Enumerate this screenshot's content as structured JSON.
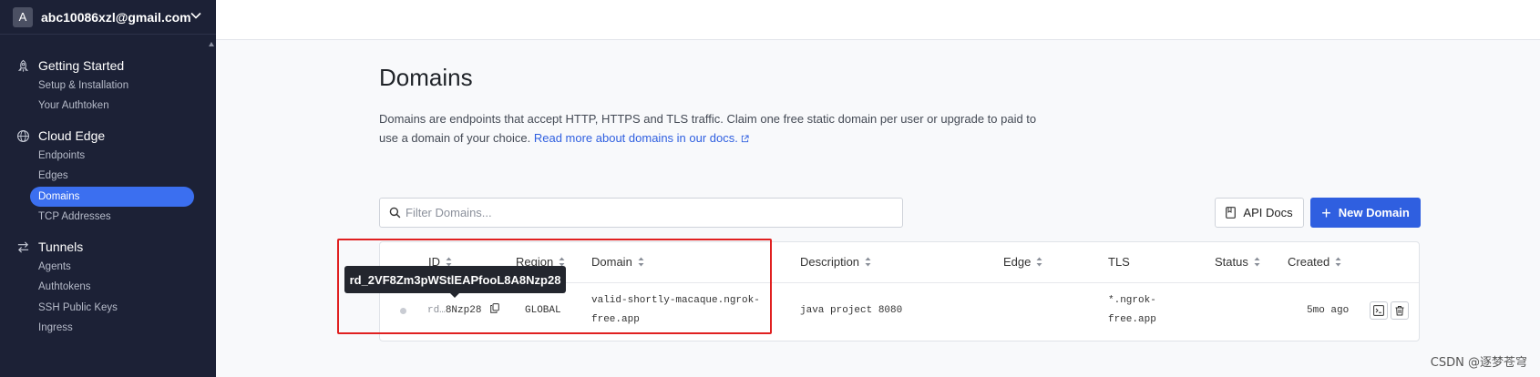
{
  "sidebar": {
    "avatar_letter": "A",
    "account_email": "abc10086xzl@gmail.com",
    "sections": {
      "getting_started": {
        "title": "Getting Started",
        "items": [
          "Setup & Installation",
          "Your Authtoken"
        ]
      },
      "cloud_edge": {
        "title": "Cloud Edge",
        "items": [
          "Endpoints",
          "Edges",
          "Domains",
          "TCP Addresses"
        ]
      },
      "tunnels": {
        "title": "Tunnels",
        "items": [
          "Agents",
          "Authtokens",
          "SSH Public Keys",
          "Ingress"
        ]
      }
    },
    "active_item": "Domains"
  },
  "main": {
    "title": "Domains",
    "description": "Domains are endpoints that accept HTTP, HTTPS and TLS traffic. Claim one free static domain per user or upgrade to paid to use a domain of your choice.",
    "docs_link": "Read more about domains in our docs.",
    "filter_placeholder": "Filter Domains...",
    "api_docs_label": "API Docs",
    "new_domain_label": "New Domain"
  },
  "table": {
    "columns": [
      "ID",
      "Region",
      "Domain",
      "Description",
      "Edge",
      "TLS",
      "Status",
      "Created"
    ],
    "rows": [
      {
        "id_prefix": "rd…",
        "id_suffix": "8Nzp28",
        "region": "GLOBAL",
        "domain_line1": "valid-shortly-macaque.ngrok-",
        "domain_line2": "free.app",
        "description": "java project 8080",
        "tls_line1": "*.ngrok-",
        "tls_line2": "free.app",
        "created": "5mo ago"
      }
    ]
  },
  "tooltip": {
    "text": "rd_2VF8Zm3pWStlEAPfooL8A8Nzp28"
  },
  "watermark": "CSDN @逐梦苍穹",
  "colors": {
    "sidebar_bg": "#1c2136",
    "accent": "#2f5fe0",
    "active_nav": "#3b6ff0",
    "highlight_border": "#e02020"
  }
}
